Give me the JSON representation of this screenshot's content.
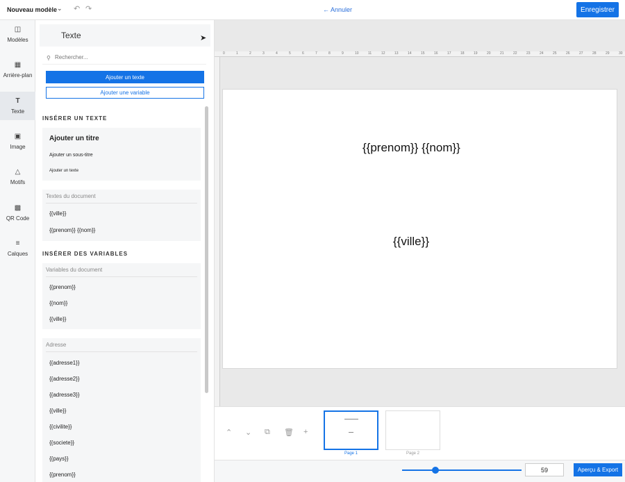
{
  "topbar": {
    "doc_title": "Nouveau modèle",
    "cancel_label": "← Annuler",
    "save_label": "Enregistrer"
  },
  "rail": {
    "items": [
      {
        "label": "Modèles",
        "icon": "templates-icon"
      },
      {
        "label": "Arrière-plan",
        "icon": "background-icon"
      },
      {
        "label": "Texte",
        "icon": "text-icon"
      },
      {
        "label": "Image",
        "icon": "image-icon"
      },
      {
        "label": "Motifs",
        "icon": "shapes-icon"
      },
      {
        "label": "QR Code",
        "icon": "qrcode-icon"
      },
      {
        "label": "Calques",
        "icon": "layers-icon"
      }
    ],
    "active": "Texte"
  },
  "panel": {
    "title": "Texte",
    "search_placeholder": "Rechercher...",
    "add_text_button": "Ajouter un texte",
    "add_variable_button": "Ajouter une variable",
    "insert_text_heading": "INSÉRER UN TEXTE",
    "text_styles": [
      "Ajouter un titre",
      "Ajouter un sous-titre",
      "Ajouter un texte"
    ],
    "doc_texts_title": "Textes du document",
    "doc_texts": [
      "{{ville}}",
      "{{prenom}} {{nom}}"
    ],
    "insert_vars_heading": "INSÉRER DES VARIABLES",
    "doc_vars_title": "Variables du document",
    "doc_vars": [
      "{{prenom}}",
      "{{nom}}",
      "{{ville}}"
    ],
    "address_title": "Adresse",
    "address_vars": [
      "{{adresse1}}",
      "{{adresse2}}",
      "{{adresse3}}",
      "{{ville}}",
      "{{civilite}}",
      "{{societe}}",
      "{{pays}}",
      "{{prenom}}"
    ]
  },
  "canvas": {
    "ruler_ticks": [
      "0",
      "1",
      "2",
      "3",
      "4",
      "5",
      "6",
      "7",
      "8",
      "9",
      "10",
      "11",
      "12",
      "13",
      "14",
      "15",
      "16",
      "17",
      "18",
      "19",
      "20",
      "21",
      "22",
      "23",
      "24",
      "25",
      "26",
      "27",
      "28",
      "29",
      "30"
    ],
    "text1": "{{prenom}} {{nom}}",
    "text2": "{{ville}}"
  },
  "pages": {
    "page1_label": "Page 1",
    "page2_label": "Page 2"
  },
  "zoom": {
    "value": "59",
    "export_label": "Aperçu & Export"
  },
  "colors": {
    "accent": "#1473e6"
  }
}
